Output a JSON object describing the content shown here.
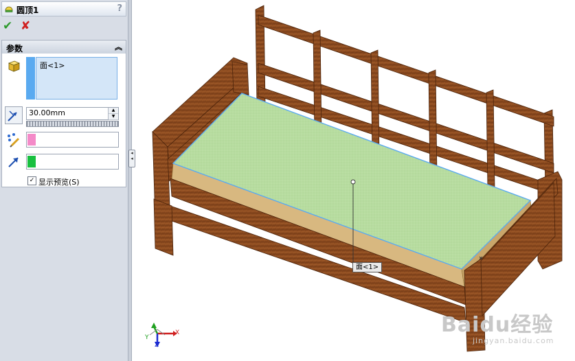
{
  "feature": {
    "title": "圆顶1",
    "help": "?"
  },
  "actions": {
    "ok": "✔",
    "cancel": "✘"
  },
  "parameters": {
    "section_title": "参数",
    "selection_items": [
      "面<1>"
    ],
    "distance_value": "30.00mm",
    "preview_checked": true,
    "preview_label": "显示预览(S)"
  },
  "viewport": {
    "face_callout": "面<1>",
    "axes": {
      "x": "X",
      "y": "Y",
      "z": "Z"
    },
    "watermark": "Baidu经验",
    "watermark_sub": "jingyan.baidu.com"
  },
  "colors": {
    "wood": "#8b4a1f",
    "face_green": "#b7dca0",
    "cushion": "#d8b880",
    "selection_blue": "#5aaaf0",
    "pink": "#f48ac8",
    "green": "#18c040"
  }
}
